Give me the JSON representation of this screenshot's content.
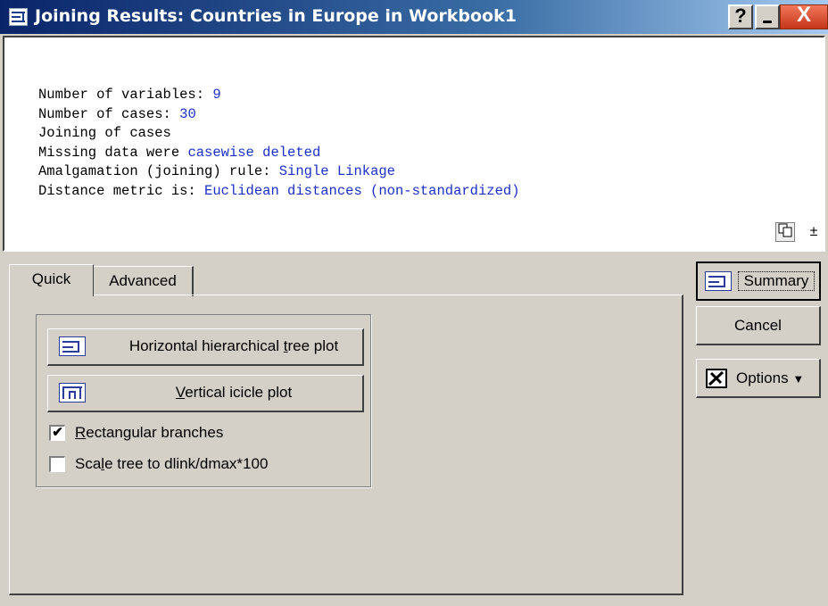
{
  "window": {
    "title": "Joining Results: Countries in Europe in Workbook1",
    "help_label": "?",
    "minimize_icon": "minimize-icon",
    "close_label": "X"
  },
  "output": {
    "lines": [
      {
        "label": "Number of variables: ",
        "value": "9"
      },
      {
        "label": "Number of cases: ",
        "value": "30"
      },
      {
        "label": "Joining of cases",
        "value": ""
      },
      {
        "label": "Missing data were ",
        "value": "casewise deleted"
      },
      {
        "label": "Amalgamation (joining) rule: ",
        "value": "Single Linkage"
      },
      {
        "label": "Distance metric is: ",
        "value": "Euclidean distances (non-standardized)"
      }
    ],
    "value_color": "#1b30c8",
    "copy_icon": "copy-icon",
    "expand_icon": "expand-icon",
    "expand_glyph": "±"
  },
  "tabs": [
    {
      "label": "Quick",
      "active": true
    },
    {
      "label": "Advanced",
      "active": false
    }
  ],
  "quick": {
    "horizontal_btn": {
      "label_pre": "Horizontal hierarchical ",
      "label_u": "t",
      "label_post": "ree plot",
      "icon": "horizontal-tree-icon"
    },
    "vertical_btn": {
      "label_pre": "",
      "label_u": "V",
      "label_post": "ertical icicle plot",
      "icon": "vertical-icicle-icon"
    },
    "rect_branches": {
      "label_pre": "",
      "label_u": "R",
      "label_post": "ectangular branches",
      "checked": true,
      "mark": "✔"
    },
    "scale_tree": {
      "label_pre": "Sca",
      "label_u": "l",
      "label_post": "e tree to dlink/dmax*100",
      "checked": false
    }
  },
  "side": {
    "summary_label": "Summary",
    "summary_icon": "summary-icon",
    "cancel_label": "Cancel",
    "options_label": "Options",
    "options_icon": "options-icon",
    "options_arrow": "▼"
  },
  "colors": {
    "title_start": "#0a246a",
    "title_end": "#a6caf0",
    "face": "#d4d0c8",
    "close": "#c4361a"
  }
}
